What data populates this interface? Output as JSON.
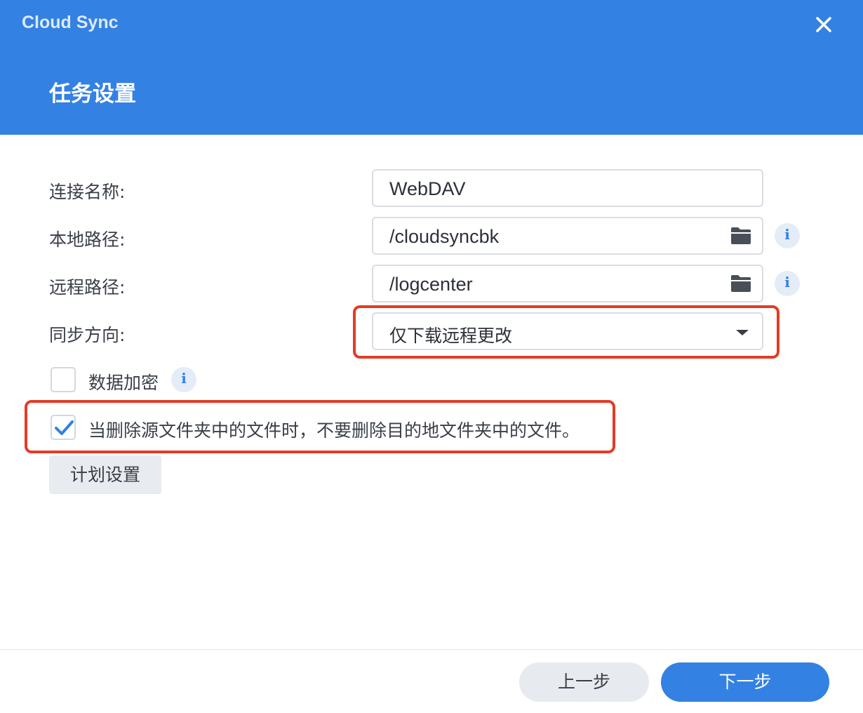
{
  "window": {
    "app_title": "Cloud Sync",
    "dialog_title": "任务设置",
    "close_icon": "close-icon"
  },
  "form": {
    "connection_name": {
      "label": "连接名称:",
      "value": "WebDAV"
    },
    "local_path": {
      "label": "本地路径:",
      "value": "/cloudsyncbk",
      "icon": "folder-icon",
      "info": "i"
    },
    "remote_path": {
      "label": "远程路径:",
      "value": "/logcenter",
      "icon": "folder-icon",
      "info": "i"
    },
    "sync_direction": {
      "label": "同步方向:",
      "value": "仅下载远程更改",
      "icon": "chevron-down-icon"
    },
    "encryption": {
      "label": "数据加密",
      "checked": false,
      "info": "i"
    },
    "keep_deleted": {
      "label": "当删除源文件夹中的文件时，不要删除目的地文件夹中的文件。",
      "checked": true
    },
    "schedule_button": "计划设置"
  },
  "footer": {
    "prev_label": "上一步",
    "next_label": "下一步"
  },
  "colors": {
    "header_bg": "#3381e3",
    "highlight": "#e23c26",
    "accent": "#3381e3"
  }
}
